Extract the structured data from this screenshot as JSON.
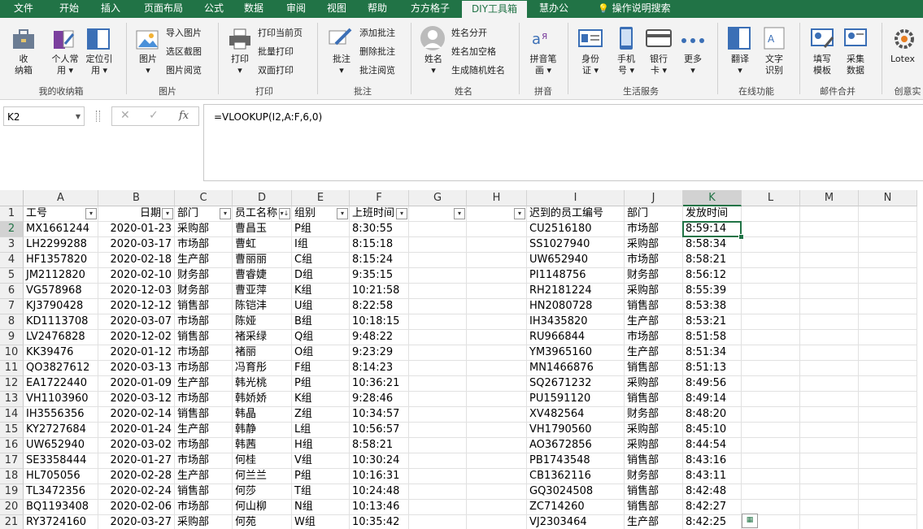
{
  "tabs": [
    "文件",
    "开始",
    "插入",
    "页面布局",
    "公式",
    "数据",
    "审阅",
    "视图",
    "帮助",
    "方方格子",
    "DIY工具箱",
    "慧办公",
    "操作说明搜索"
  ],
  "active_tab": "DIY工具箱",
  "ribbon": {
    "collect": {
      "btn1": "收\n纳箱",
      "btn2": "个人常\n用 ▾",
      "btn3": "定位引\n用 ▾",
      "group": "我的收纳箱"
    },
    "image": {
      "btn": "图片\n▾",
      "s1": "导入图片",
      "s2": "选区截图",
      "s3": "图片阅览",
      "group": "图片"
    },
    "print": {
      "btn": "打印\n▾",
      "s1": "打印当前页",
      "s2": "批量打印",
      "s3": "双面打印",
      "group": "打印"
    },
    "comment": {
      "btn": "批注\n▾",
      "s1": "添加批注",
      "s2": "删除批注",
      "s3": "批注阅览",
      "group": "批注"
    },
    "name": {
      "btn": "姓名\n▾",
      "s1": "姓名分开",
      "s2": "姓名加空格",
      "s3": "生成随机姓名",
      "group": "姓名"
    },
    "pinyin": {
      "btn": "拼音笔\n画 ▾",
      "group": "拼音"
    },
    "life": {
      "b1": "身份\n证 ▾",
      "b2": "手机\n号 ▾",
      "b3": "银行\n卡 ▾",
      "b4": "更多\n▾",
      "group": "生活服务"
    },
    "online": {
      "b1": "翻译\n▾",
      "b2": "文字\n识别",
      "group": "在线功能"
    },
    "mail": {
      "b1": "填写\n模板",
      "b2": "采集\n数据",
      "group": "邮件合并"
    },
    "lotex": {
      "b1": "Lotex",
      "group": "创意实"
    }
  },
  "name_box": "K2",
  "formula": "=VLOOKUP(I2,A:F,6,0)",
  "columns": [
    "A",
    "B",
    "C",
    "D",
    "E",
    "F",
    "G",
    "H",
    "I",
    "J",
    "K",
    "L",
    "M",
    "N"
  ],
  "selected_col": "K",
  "rows": [
    [
      "工号",
      "日期",
      "部门",
      "员工名称",
      "组别",
      "上班时间",
      "",
      "",
      "迟到的员工编号",
      "部门",
      "发放时间",
      "",
      "",
      ""
    ],
    [
      "MX1661244",
      "2020-01-23",
      "采购部",
      "曹昌玉",
      "P组",
      "8:30:55",
      "",
      "",
      "CU2516180",
      "市场部",
      "8:59:14",
      "",
      "",
      ""
    ],
    [
      "LH2299288",
      "2020-03-17",
      "市场部",
      "曹虹",
      "I组",
      "8:15:18",
      "",
      "",
      "SS1027940",
      "采购部",
      "8:58:34",
      "",
      "",
      ""
    ],
    [
      "HF1357820",
      "2020-02-18",
      "生产部",
      "曹丽丽",
      "C组",
      "8:15:24",
      "",
      "",
      "UW652940",
      "市场部",
      "8:58:21",
      "",
      "",
      ""
    ],
    [
      "JM2112820",
      "2020-02-10",
      "财务部",
      "曹睿婕",
      "D组",
      "9:35:15",
      "",
      "",
      "PI1148756",
      "财务部",
      "8:56:12",
      "",
      "",
      ""
    ],
    [
      "VG578968",
      "2020-12-03",
      "财务部",
      "曹亚萍",
      "K组",
      "10:21:58",
      "",
      "",
      "RH2181224",
      "采购部",
      "8:55:39",
      "",
      "",
      ""
    ],
    [
      "KJ3790428",
      "2020-12-12",
      "销售部",
      "陈铠沣",
      "U组",
      "8:22:58",
      "",
      "",
      "HN2080728",
      "销售部",
      "8:53:38",
      "",
      "",
      ""
    ],
    [
      "KD1113708",
      "2020-03-07",
      "市场部",
      "陈娅",
      "B组",
      "10:18:15",
      "",
      "",
      "IH3435820",
      "生产部",
      "8:53:21",
      "",
      "",
      ""
    ],
    [
      "LV2476828",
      "2020-12-02",
      "销售部",
      "褚采绿",
      "Q组",
      "9:48:22",
      "",
      "",
      "RU966844",
      "市场部",
      "8:51:58",
      "",
      "",
      ""
    ],
    [
      "KK39476",
      "2020-01-12",
      "市场部",
      "褚丽",
      "O组",
      "9:23:29",
      "",
      "",
      "YM3965160",
      "生产部",
      "8:51:34",
      "",
      "",
      ""
    ],
    [
      "QO3827612",
      "2020-03-13",
      "市场部",
      "冯育彤",
      "F组",
      "8:14:23",
      "",
      "",
      "MN1466876",
      "销售部",
      "8:51:13",
      "",
      "",
      ""
    ],
    [
      "EA1722440",
      "2020-01-09",
      "生产部",
      "韩光桃",
      "P组",
      "10:36:21",
      "",
      "",
      "SQ2671232",
      "采购部",
      "8:49:56",
      "",
      "",
      ""
    ],
    [
      "VH1103960",
      "2020-03-12",
      "市场部",
      "韩娇娇",
      "K组",
      "9:28:46",
      "",
      "",
      "PU1591120",
      "销售部",
      "8:49:14",
      "",
      "",
      ""
    ],
    [
      "IH3556356",
      "2020-02-14",
      "销售部",
      "韩晶",
      "Z组",
      "10:34:57",
      "",
      "",
      "XV482564",
      "财务部",
      "8:48:20",
      "",
      "",
      ""
    ],
    [
      "KY2727684",
      "2020-01-24",
      "生产部",
      "韩静",
      "L组",
      "10:56:57",
      "",
      "",
      "VH1790560",
      "采购部",
      "8:45:10",
      "",
      "",
      ""
    ],
    [
      "UW652940",
      "2020-03-02",
      "市场部",
      "韩茜",
      "H组",
      "8:58:21",
      "",
      "",
      "AO3672856",
      "采购部",
      "8:44:54",
      "",
      "",
      ""
    ],
    [
      "SE3358444",
      "2020-01-27",
      "市场部",
      "何桂",
      "V组",
      "10:30:24",
      "",
      "",
      "PB1743548",
      "销售部",
      "8:43:16",
      "",
      "",
      ""
    ],
    [
      "HL705056",
      "2020-02-28",
      "生产部",
      "何兰兰",
      "P组",
      "10:16:31",
      "",
      "",
      "CB1362116",
      "财务部",
      "8:43:11",
      "",
      "",
      ""
    ],
    [
      "TL3472356",
      "2020-02-24",
      "销售部",
      "何莎",
      "T组",
      "10:24:48",
      "",
      "",
      "GQ3024508",
      "销售部",
      "8:42:48",
      "",
      "",
      ""
    ],
    [
      "BQ1193408",
      "2020-02-06",
      "市场部",
      "何山柳",
      "N组",
      "10:13:46",
      "",
      "",
      "ZC714260",
      "销售部",
      "8:42:27",
      "",
      "",
      ""
    ],
    [
      "RY3724160",
      "2020-03-27",
      "采购部",
      "何苑",
      "W组",
      "10:35:42",
      "",
      "",
      "VJ2303464",
      "生产部",
      "8:42:25",
      "",
      "",
      ""
    ]
  ],
  "row_numbers": [
    "1",
    "2",
    "3",
    "4",
    "5",
    "6",
    "7",
    "8",
    "9",
    "10",
    "11",
    "12",
    "13",
    "14",
    "15",
    "16",
    "17",
    "18",
    "19",
    "20",
    "21"
  ],
  "filter_cols": [
    0,
    1,
    2,
    3,
    4,
    5,
    6,
    7
  ],
  "sort_col": 3,
  "colors": {
    "accent": "#217346"
  }
}
